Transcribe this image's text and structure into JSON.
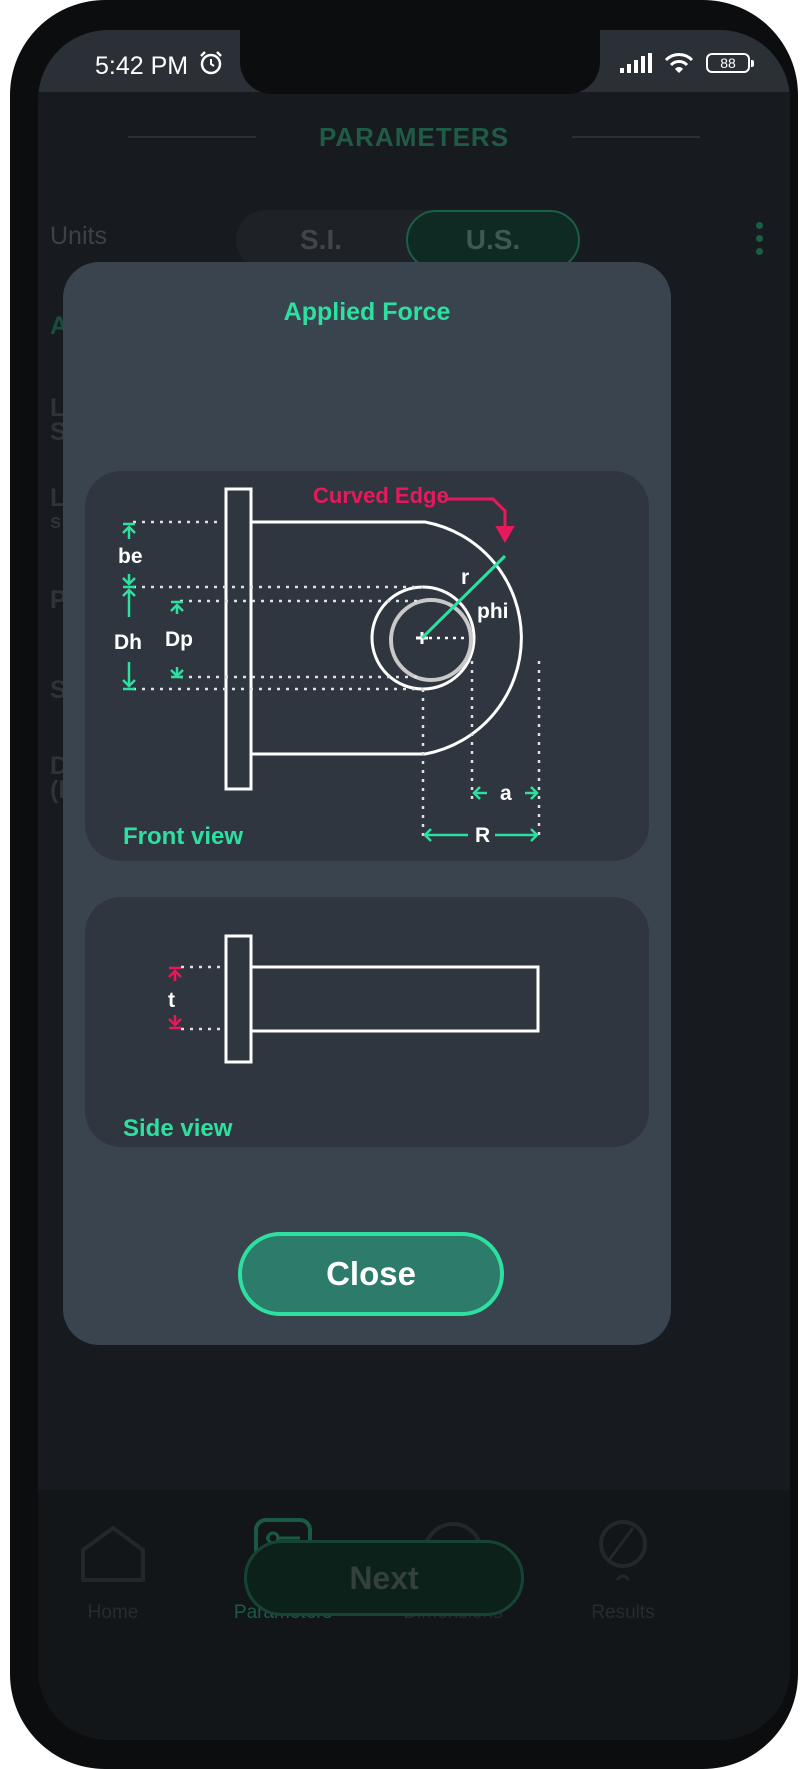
{
  "status_bar": {
    "time": "5:42 PM",
    "battery": "88"
  },
  "header": {
    "title": "PARAMETERS"
  },
  "units": {
    "label": "Units",
    "option_si": "S.I.",
    "option_us": "U.S.",
    "selected": "U.S."
  },
  "background_rows": [
    "A",
    "L",
    "S",
    "L",
    "s",
    "P",
    "S",
    "D",
    "(N"
  ],
  "next_button": {
    "label": "Next"
  },
  "bottom_nav": {
    "items": [
      {
        "label": "Home"
      },
      {
        "label": "Parameters",
        "active": true
      },
      {
        "label": "Dimensions"
      },
      {
        "label": "Results"
      }
    ]
  },
  "modal": {
    "title": "Applied Force",
    "front_view": {
      "caption": "Front view",
      "labels": {
        "curved_edge": "Curved Edge",
        "be": "be",
        "Dh": "Dh",
        "Dp": "Dp",
        "r": "r",
        "phi": "phi",
        "a": "a",
        "R": "R"
      }
    },
    "side_view": {
      "caption": "Side view",
      "labels": {
        "t": "t"
      }
    },
    "close_label": "Close"
  },
  "colors": {
    "accent": "#2ee0a0",
    "highlight": "#e8195b",
    "modal_bg": "#3a444f",
    "panel_bg": "#2f363f",
    "button_bg": "#2c7b6b"
  }
}
